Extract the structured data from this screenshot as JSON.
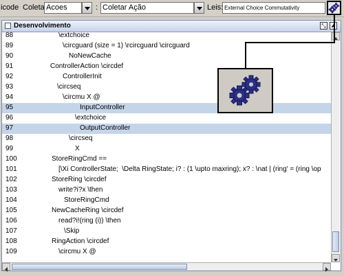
{
  "toolbar": {
    "label_partial": "icode",
    "coletar_label": "Coletar",
    "acoes_value": "Acoes",
    "colon": ":",
    "coletar_acao_value": "Coletar Ação",
    "leis_label": "Leis:",
    "leis_value": "External Choice Commutativity",
    "gear_icon": "gears-icon"
  },
  "window": {
    "title": "Desenvolvimento",
    "restore_glyph": "⤡",
    "maximize_glyph": "⬈"
  },
  "editor": {
    "lines": [
      {
        "num": "88",
        "code": "\\extchoice",
        "indent": 82,
        "selected": false
      },
      {
        "num": "89",
        "code": "\\circguard (size = 1) \\rcircguard \\circguard",
        "indent": 88,
        "selected": false
      },
      {
        "num": "90",
        "code": "NoNewCache",
        "indent": 97,
        "selected": false
      },
      {
        "num": "91",
        "code": "ControllerAction \\circdef",
        "indent": 70,
        "selected": false
      },
      {
        "num": "92",
        "code": "ControllerInit",
        "indent": 88,
        "selected": false
      },
      {
        "num": "93",
        "code": "\\circseq",
        "indent": 80,
        "selected": false
      },
      {
        "num": "94",
        "code": "\\circmu X @",
        "indent": 88,
        "selected": false
      },
      {
        "num": "95",
        "code": "InputController",
        "indent": 113,
        "selected": true
      },
      {
        "num": "96",
        "code": "\\extchoice",
        "indent": 106,
        "selected": false
      },
      {
        "num": "97",
        "code": "OutputController",
        "indent": 113,
        "selected": true
      },
      {
        "num": "98",
        "code": "\\circseq",
        "indent": 97,
        "selected": false
      },
      {
        "num": "99",
        "code": "X",
        "indent": 106,
        "selected": false
      },
      {
        "num": "100",
        "code": "StoreRingCmd ==",
        "indent": 72,
        "selected": false
      },
      {
        "num": "101",
        "code": "[\\Xi ControllerState;  \\Delta RingState; i? : (1 \\upto maxring); x? : \\nat | (ring' = (ring \\op",
        "indent": 82,
        "selected": false
      },
      {
        "num": "102",
        "code": "StoreRing \\circdef",
        "indent": 72,
        "selected": false
      },
      {
        "num": "103",
        "code": "write?i?x \\then",
        "indent": 82,
        "selected": false
      },
      {
        "num": "104",
        "code": "StoreRingCmd",
        "indent": 90,
        "selected": false
      },
      {
        "num": "105",
        "code": "NewCacheRing \\circdef",
        "indent": 72,
        "selected": false
      },
      {
        "num": "106",
        "code": "read?i!(ring (i)) \\then",
        "indent": 82,
        "selected": false
      },
      {
        "num": "107",
        "code": "\\Skip",
        "indent": 90,
        "selected": false
      },
      {
        "num": "108",
        "code": "RingAction \\circdef",
        "indent": 72,
        "selected": false
      },
      {
        "num": "109",
        "code": "\\circmu X @",
        "indent": 82,
        "selected": false
      }
    ]
  }
}
